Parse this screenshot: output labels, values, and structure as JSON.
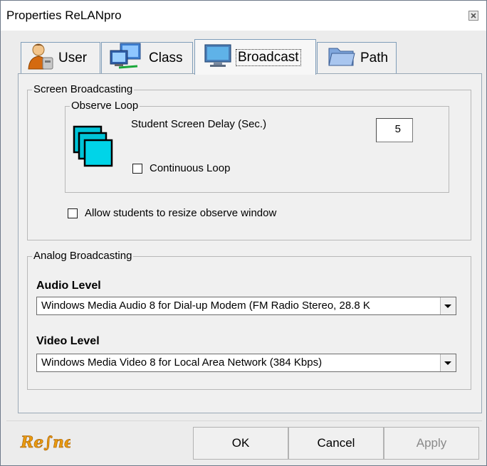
{
  "window": {
    "title": "Properties ReLANpro"
  },
  "tabs": [
    {
      "label": "User"
    },
    {
      "label": "Class"
    },
    {
      "label": "Broadcast"
    },
    {
      "label": "Path"
    }
  ],
  "screen_broadcasting": {
    "title": "Screen Broadcasting",
    "observe_loop": {
      "title": "Observe Loop",
      "delay_label": "Student Screen Delay (Sec.)",
      "delay_value": "5",
      "continuous_loop_label": "Continuous Loop",
      "continuous_loop_checked": false
    },
    "allow_resize_label": "Allow students to resize observe window",
    "allow_resize_checked": false
  },
  "analog_broadcasting": {
    "title": "Analog Broadcasting",
    "audio_level_label": "Audio Level",
    "audio_level_value": "Windows Media Audio 8 for Dial-up Modem (FM Radio Stereo, 28.8 K",
    "video_level_label": "Video Level",
    "video_level_value": "Windows Media Video 8 for Local Area Network (384 Kbps)"
  },
  "buttons": {
    "ok": "OK",
    "cancel": "Cancel",
    "apply": "Apply"
  },
  "logo_text": "Re∫net",
  "colors": {
    "accent": "#00b4d8",
    "logo_orange": "#e89a10"
  }
}
